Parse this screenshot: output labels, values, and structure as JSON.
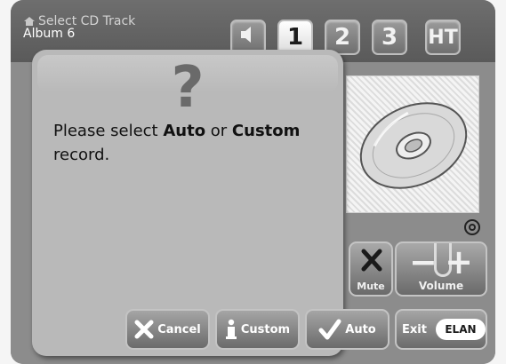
{
  "header": {
    "title": "Select CD Track",
    "subtitle": "Album 6"
  },
  "zones": {
    "z1": "1",
    "z2": "2",
    "z3": "3",
    "ht": "HT"
  },
  "dialog": {
    "message_prefix": "Please select ",
    "option_auto": "Auto",
    "message_middle": " or ",
    "option_custom": "Custom",
    "message_suffix": "record."
  },
  "controls": {
    "mute_label": "Mute",
    "volume_label": "Volume",
    "volume_minus": "−",
    "volume_plus": "+"
  },
  "actions": {
    "cancel_label": "Cancel",
    "custom_label": "Custom",
    "auto_label": "Auto",
    "exit_label": "Exit",
    "brand": "ELAN"
  }
}
